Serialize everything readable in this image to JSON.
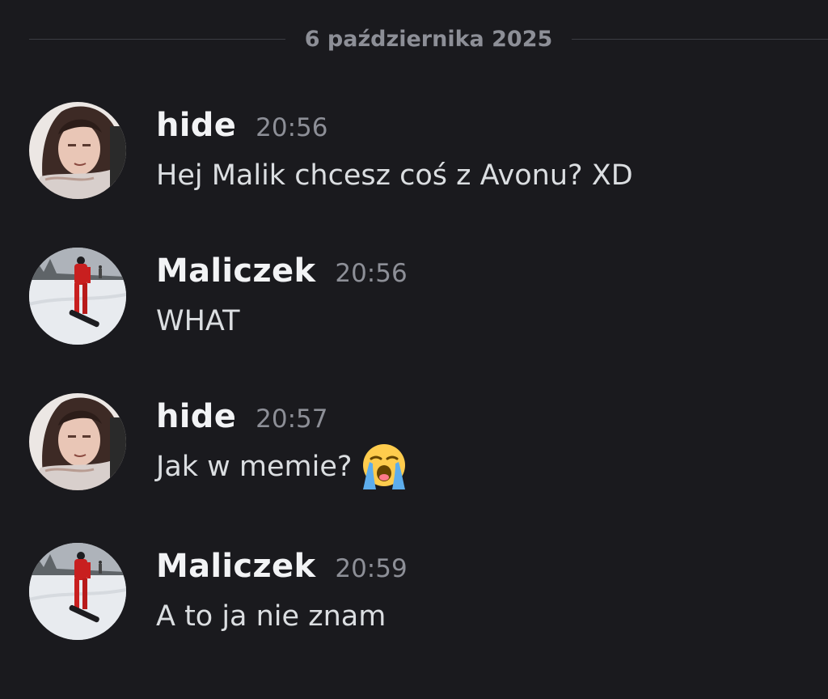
{
  "divider": {
    "date": "6 października 2025"
  },
  "messages": [
    {
      "author": "hide",
      "time": "20:56",
      "text": "Hej Malik chcesz coś z Avonu? XD",
      "avatar": "hide-avatar",
      "emoji": ""
    },
    {
      "author": "Maliczek",
      "time": "20:56",
      "text": "WHAT",
      "avatar": "maliczek-avatar",
      "emoji": ""
    },
    {
      "author": "hide",
      "time": "20:57",
      "text": "Jak w memie?",
      "avatar": "hide-avatar",
      "emoji": "loudly-crying-face-emoji"
    },
    {
      "author": "Maliczek",
      "time": "20:59",
      "text": "A to ja nie znam",
      "avatar": "maliczek-avatar",
      "emoji": ""
    }
  ],
  "colors": {
    "background": "#1a1a1e",
    "username": "#f2f3f5",
    "timestamp": "#8d8f97",
    "message_text": "#dbdee1",
    "divider_line": "#3c3d44"
  }
}
